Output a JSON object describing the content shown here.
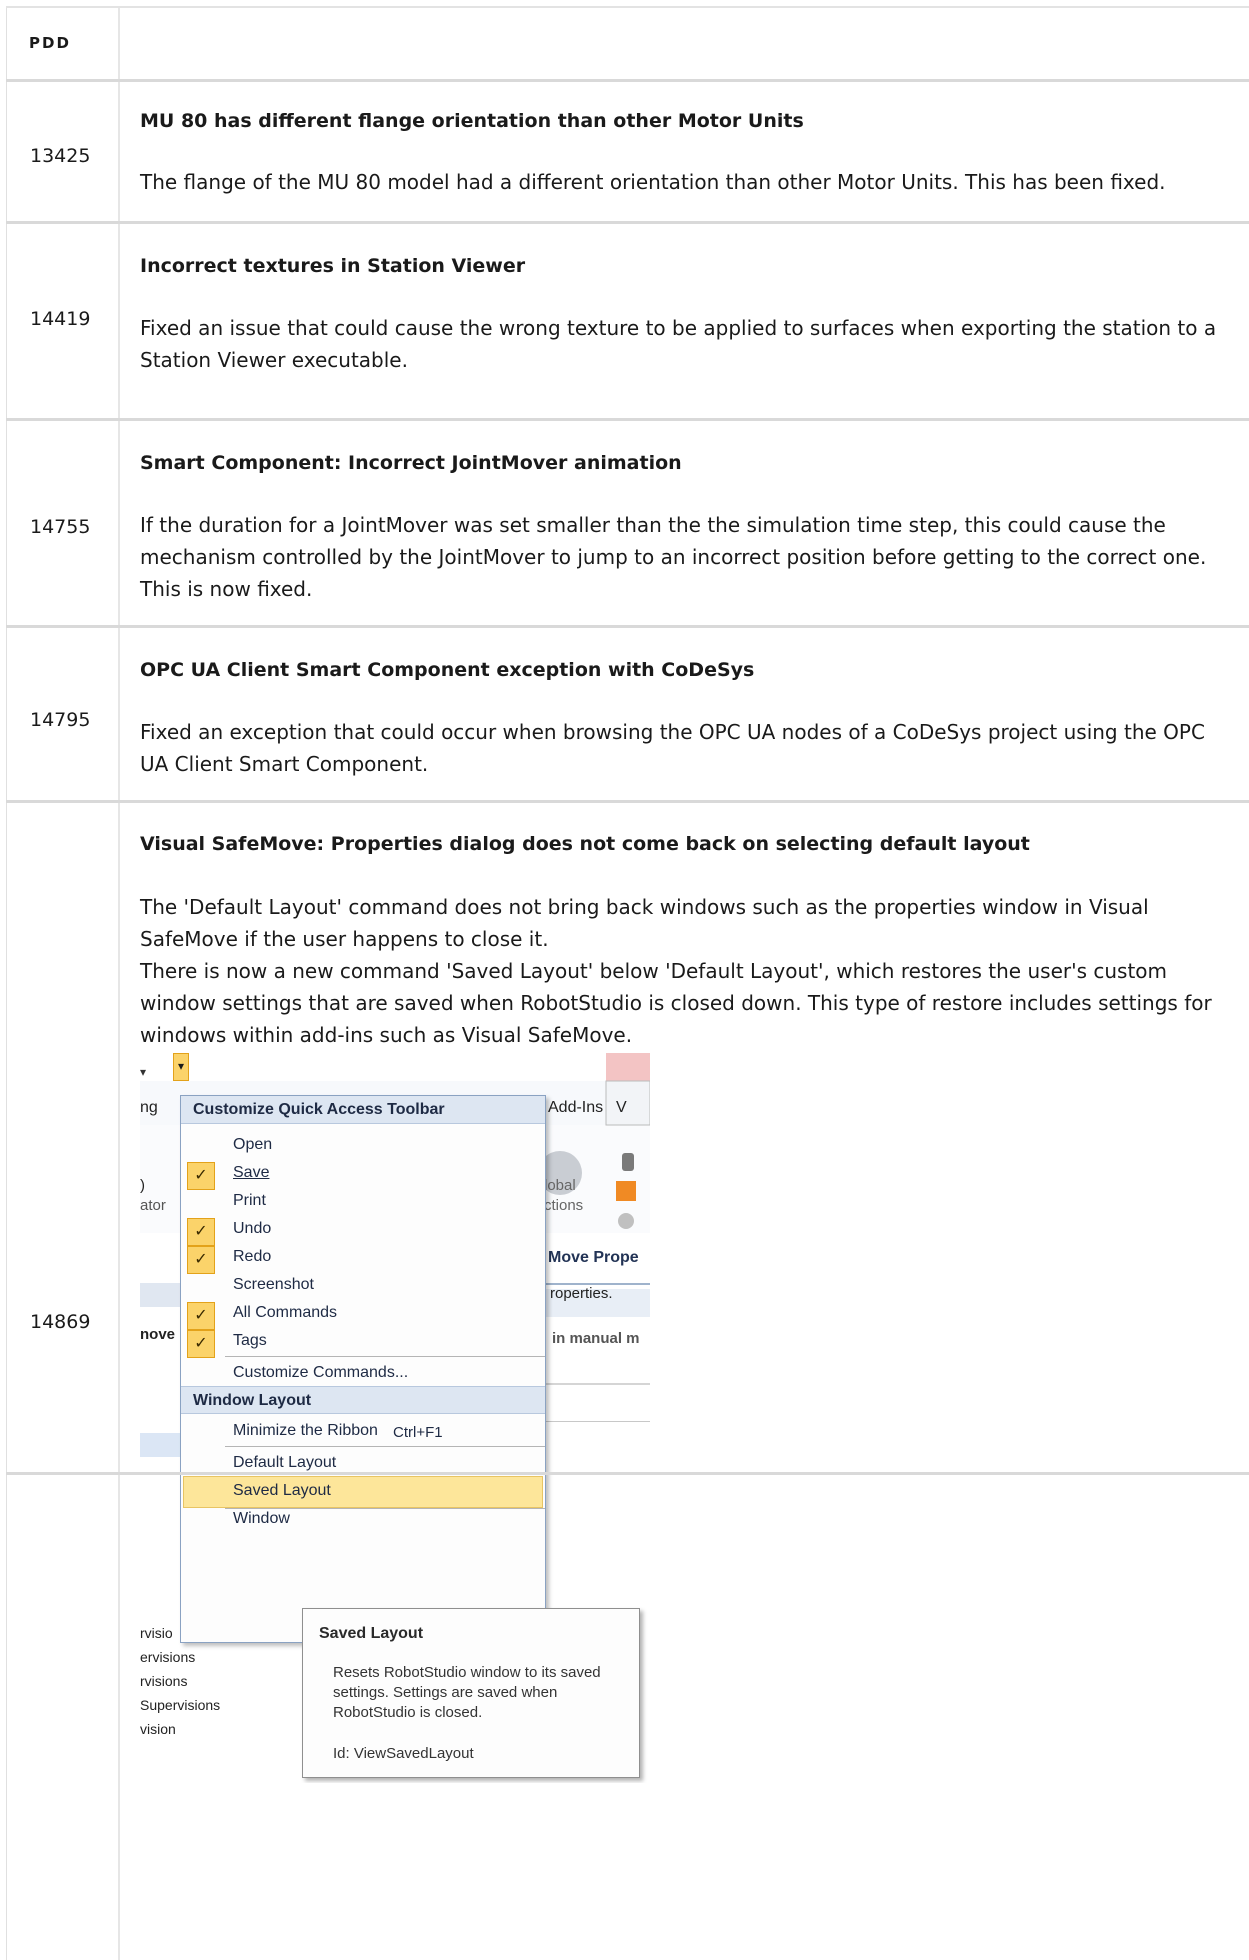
{
  "header": {
    "col1": "PDD"
  },
  "rows": [
    {
      "pdd": "13425",
      "title": "MU 80 has different flange orientation than other Motor Units",
      "desc": "The flange of the MU 80 model had a different orientation than other Motor Units. This has been fixed."
    },
    {
      "pdd": "14419",
      "title": "Incorrect textures in Station Viewer",
      "desc": "Fixed an issue that could cause the wrong texture to be applied to surfaces when exporting the station to a Station Viewer executable."
    },
    {
      "pdd": "14755",
      "title": "Smart Component: Incorrect JointMover animation",
      "desc": "If the duration for a JointMover was set smaller than the the simulation time step, this could cause the mechanism controlled by the JointMover to jump to an incorrect position before getting to the correct one. This is now fixed."
    },
    {
      "pdd": "14795",
      "title": "OPC UA Client Smart Component exception with CoDeSys",
      "desc": "Fixed an exception that could occur when browsing the OPC UA nodes of a CoDeSys project using the OPC UA Client Smart Component."
    },
    {
      "pdd": "14869",
      "title": "Visual SafeMove: Properties dialog does not come back on selecting default layout",
      "desc": "The 'Default Layout' command does not bring back windows such as the properties window in Visual SafeMove if the user happens to close it.",
      "desc2": "There is now a new command 'Saved Layout' below 'Default Layout', which restores the user's custom window settings that are saved when RobotStudio is closed down. This type of restore includes settings for windows within add-ins such as Visual SafeMove."
    }
  ],
  "screenshot": {
    "bg": {
      "tab_add_ins": "Add-Ins",
      "tab_partial_left": "ng",
      "tab_partial_right": "V",
      "global": "lobal",
      "actions": "ctions",
      "bg_ator": "ator",
      "bg_paren": ")",
      "move_prope": "Move Prope",
      "roperties": "roperties.",
      "in_manual": "in manual m",
      "nove": "nove",
      "visions": [
        "rvisio",
        "ervisions",
        "rvisions",
        "Supervisions",
        "vision"
      ]
    },
    "menu": {
      "header1": "Customize Quick Access Toolbar",
      "items": [
        "Open",
        "Save",
        "Print",
        "Undo",
        "Redo",
        "Screenshot",
        "All Commands",
        "Tags"
      ],
      "customize": "Customize Commands...",
      "header2": "Window Layout",
      "minimize": "Minimize the Ribbon",
      "minimize_shortcut": "Ctrl+F1",
      "default_layout": "Default Layout",
      "saved_layout": "Saved Layout",
      "window_partial": "Window"
    },
    "tooltip": {
      "title": "Saved Layout",
      "body": "Resets RobotStudio window to its saved settings. Settings are saved when RobotStudio is closed.",
      "id": "Id: ViewSavedLayout"
    },
    "colors": {
      "check_fill": "#fbd36a",
      "highlight": "#fde69a",
      "menu_header": "#dde6f2"
    }
  }
}
